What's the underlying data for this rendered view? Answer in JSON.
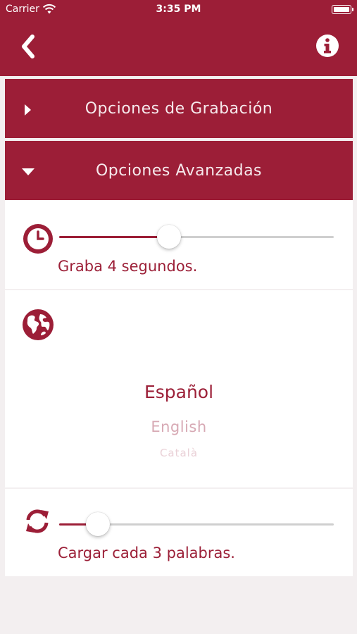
{
  "status": {
    "carrier": "Carrier",
    "time": "3:35 PM"
  },
  "nav": {
    "back_icon": "chevron-left-icon",
    "info_icon": "info-circle-icon"
  },
  "sections": {
    "recording": {
      "label": "Opciones de Grabación",
      "expanded": false
    },
    "advanced": {
      "label": "Opciones Avanzadas",
      "expanded": true
    }
  },
  "settings": {
    "duration": {
      "icon": "clock-icon",
      "label": "Graba 4 segundos.",
      "slider_fraction": 0.4
    },
    "language": {
      "icon": "globe-icon",
      "options": [
        "Español",
        "English",
        "Català"
      ],
      "selected": "Español"
    },
    "load": {
      "icon": "refresh-icon",
      "label": "Cargar cada 3 palabras.",
      "slider_fraction": 0.14
    }
  },
  "colors": {
    "brand": "#9c1e37",
    "background": "#f3eff0",
    "track": "#cfcfcf"
  }
}
